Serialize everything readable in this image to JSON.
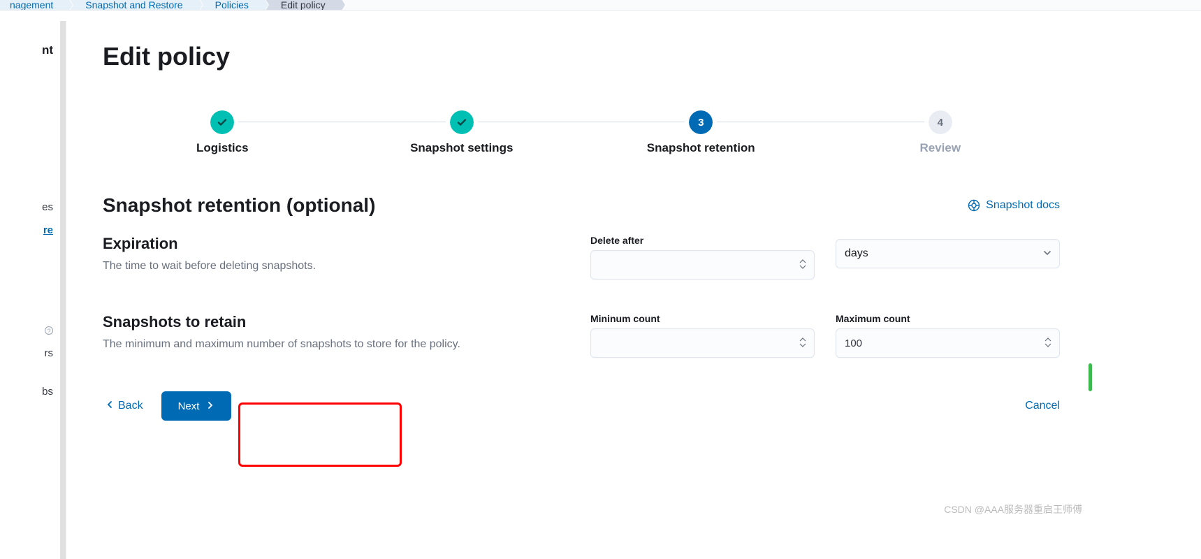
{
  "breadcrumbs": {
    "items": [
      "nagement",
      "Snapshot and Restore",
      "Policies",
      "Edit policy"
    ]
  },
  "sidebar": {
    "heading": "nt",
    "items": [
      "es",
      "re",
      "rs",
      "bs"
    ],
    "active_index": 1
  },
  "page": {
    "title": "Edit policy"
  },
  "stepper": {
    "steps": [
      {
        "label": "Logistics",
        "state": "done"
      },
      {
        "label": "Snapshot settings",
        "state": "done"
      },
      {
        "label": "Snapshot retention",
        "state": "current",
        "number": "3"
      },
      {
        "label": "Review",
        "state": "upcoming",
        "number": "4"
      }
    ]
  },
  "section": {
    "title": "Snapshot retention (optional)",
    "docs_link": "Snapshot docs"
  },
  "expiration": {
    "heading": "Expiration",
    "desc": "The time to wait before deleting snapshots.",
    "delete_after_label": "Delete after",
    "delete_after_value": "",
    "unit_label": "",
    "unit_value": "days"
  },
  "retain": {
    "heading": "Snapshots to retain",
    "desc": "The minimum and maximum number of snapshots to store for the policy.",
    "min_label": "Mininum count",
    "min_value": "",
    "max_label": "Maximum count",
    "max_value": "100"
  },
  "footer": {
    "back": "Back",
    "next": "Next",
    "cancel": "Cancel"
  },
  "watermark": "CSDN @AAA服务器重启王师傅"
}
